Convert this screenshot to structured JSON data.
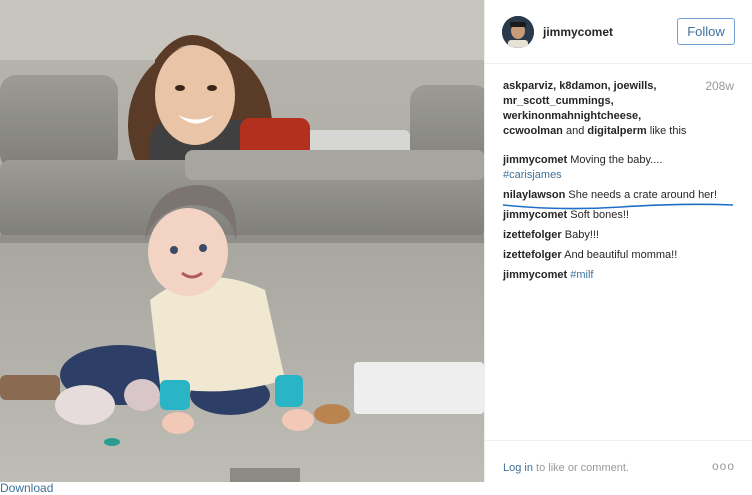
{
  "post": {
    "username": "jimmycomet",
    "follow_label": "Follow",
    "age": "208w",
    "likers_line1": "askparviz, k8damon, joewills,",
    "likers_line2": "mr_scott_cummings,",
    "likers_line3": "werkinonmahnightcheese,",
    "likers_line4_user1": "ccwoolman",
    "likers_and": "and",
    "likers_line4_user2": "digitalperm",
    "likers_suffix": "like this"
  },
  "comments": [
    {
      "user": "jimmycomet",
      "text": "Moving the baby....",
      "tag": "#carisjames"
    },
    {
      "user": "nilaylawson",
      "text": "She needs a crate around her!"
    },
    {
      "user": "jimmycomet",
      "text": "Soft bones!!"
    },
    {
      "user": "izettefolger",
      "text": "Baby!!!"
    },
    {
      "user": "izettefolger",
      "text": "And beautiful momma!!"
    },
    {
      "user": "jimmycomet",
      "text": "",
      "tag": "#milf"
    }
  ],
  "footer": {
    "login_link": "Log in",
    "login_suffix": "to like or comment.",
    "more_label": "ooo"
  },
  "download_label": "Download",
  "colors": {
    "link_blue": "#3f729b",
    "follow_border": "#70a0d4",
    "annotation_underline": "#1f6fc9"
  },
  "icons": {
    "more": "ellipsis-icon"
  }
}
